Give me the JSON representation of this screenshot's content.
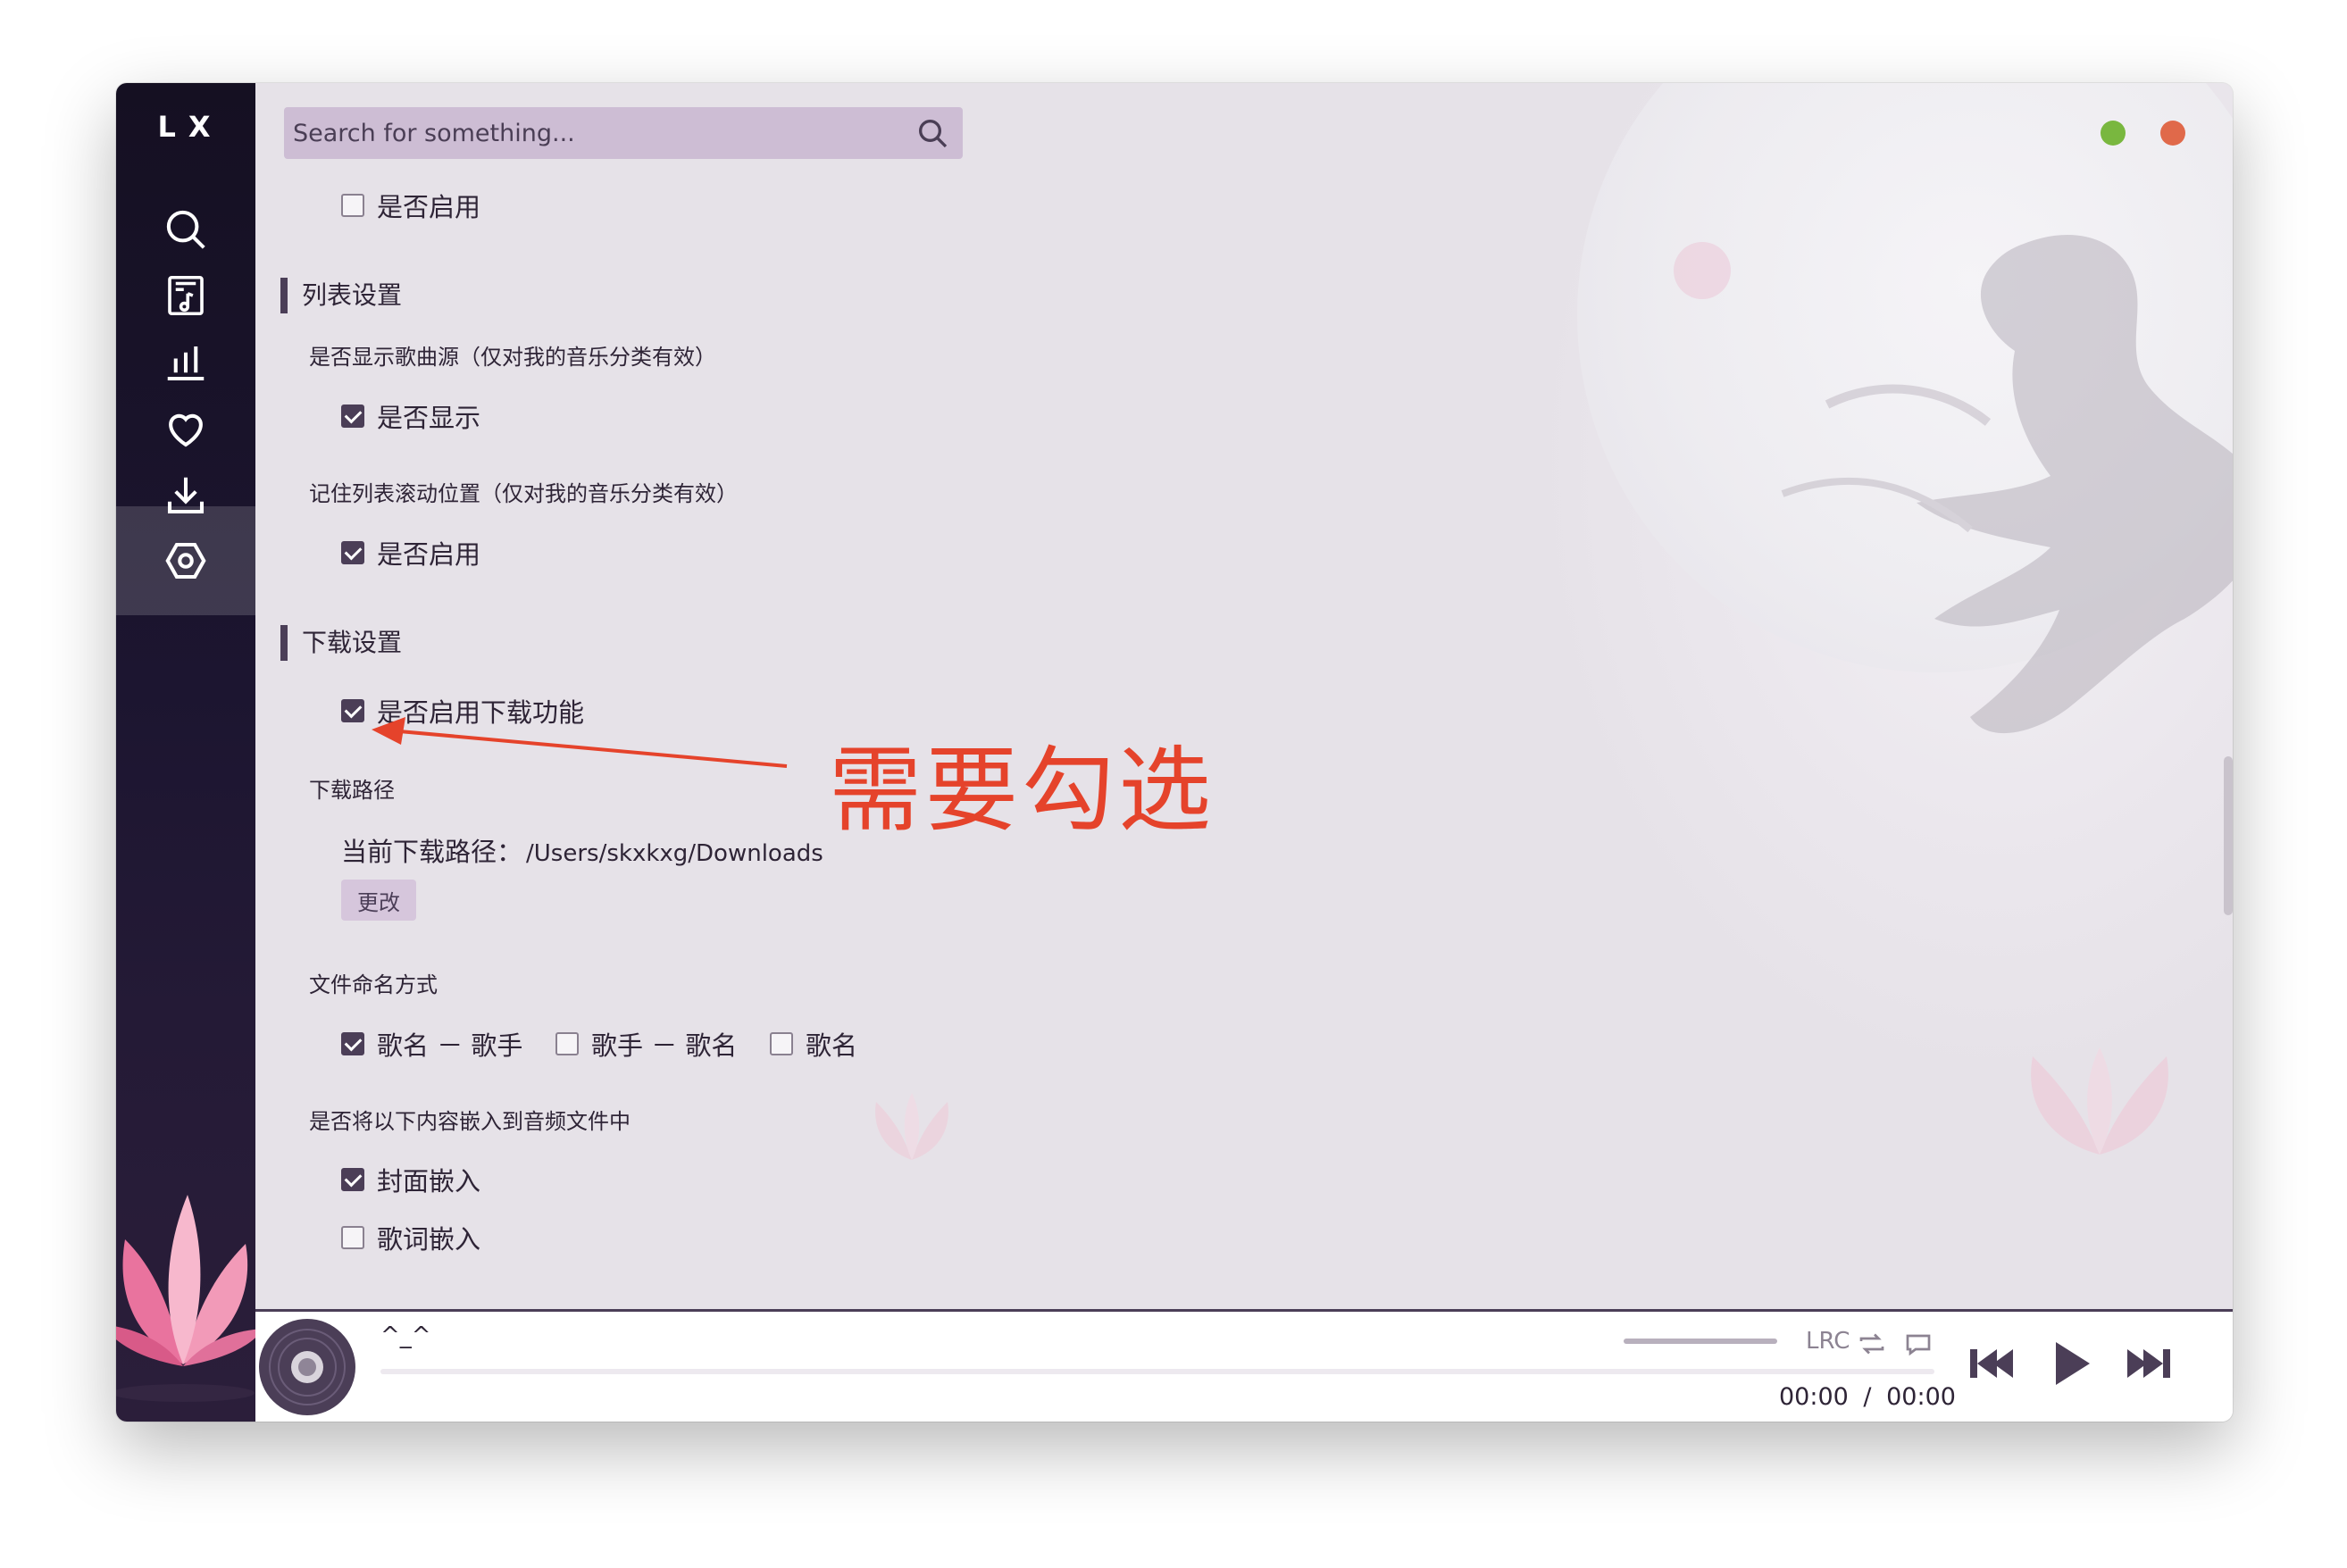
{
  "app": {
    "logo": "LX"
  },
  "sidebar": {
    "items": [
      {
        "name": "search",
        "icon": "search-icon",
        "active": false
      },
      {
        "name": "song-list",
        "icon": "music-file-icon",
        "active": false
      },
      {
        "name": "leaderboard",
        "icon": "bar-chart-icon",
        "active": false
      },
      {
        "name": "favorites",
        "icon": "heart-icon",
        "active": false
      },
      {
        "name": "download",
        "icon": "download-icon",
        "active": false
      },
      {
        "name": "settings",
        "icon": "settings-icon",
        "active": true
      }
    ]
  },
  "search": {
    "placeholder": "Search for something..."
  },
  "window_controls": {
    "minimize_color": "#79b73f",
    "close_color": "#e0694a"
  },
  "settings": {
    "top_option": {
      "label": "是否启用",
      "checked": false
    },
    "list_section": {
      "title": "列表设置",
      "show_source": {
        "label": "是否显示歌曲源（仅对我的音乐分类有效）",
        "option": "是否显示",
        "checked": true
      },
      "remember_scroll": {
        "label": "记住列表滚动位置（仅对我的音乐分类有效）",
        "option": "是否启用",
        "checked": true
      }
    },
    "download_section": {
      "title": "下载设置",
      "enable_download": {
        "option": "是否启用下载功能",
        "checked": true
      },
      "path": {
        "label": "下载路径",
        "current_prefix": "当前下载路径：",
        "current_value": "/Users/skxkxg/Downloads",
        "change_button": "更改"
      },
      "naming": {
        "label": "文件命名方式",
        "options": [
          {
            "label": "歌名 － 歌手",
            "checked": true
          },
          {
            "label": "歌手 － 歌名",
            "checked": false
          },
          {
            "label": "歌名",
            "checked": false
          }
        ]
      },
      "embed": {
        "label": "是否将以下内容嵌入到音频文件中",
        "options": [
          {
            "label": "封面嵌入",
            "checked": true
          },
          {
            "label": "歌词嵌入",
            "checked": false
          }
        ]
      }
    }
  },
  "annotation": {
    "text": "需要勾选",
    "color": "#e5432b"
  },
  "player": {
    "title": "^_^",
    "time_current": "00:00",
    "time_separator": "/",
    "time_total": "00:00",
    "lrc_label": "LRC",
    "accent": "#4b3e57"
  }
}
